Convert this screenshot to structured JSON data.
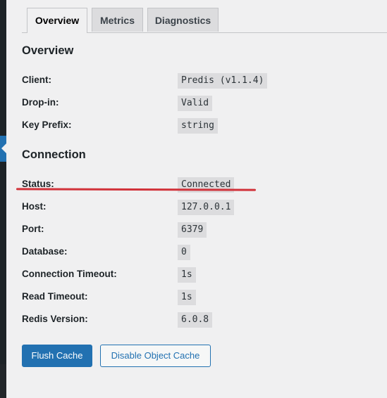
{
  "tabs": [
    {
      "label": "Overview",
      "active": true
    },
    {
      "label": "Metrics",
      "active": false
    },
    {
      "label": "Diagnostics",
      "active": false
    }
  ],
  "overview": {
    "heading": "Overview",
    "rows": [
      {
        "label": "Client:",
        "value": "Predis (v1.1.4)"
      },
      {
        "label": "Drop-in:",
        "value": "Valid"
      },
      {
        "label": "Key Prefix:",
        "value": "string"
      }
    ]
  },
  "connection": {
    "heading": "Connection",
    "rows": [
      {
        "label": "Status:",
        "value": "Connected"
      },
      {
        "label": "Host:",
        "value": "127.0.0.1"
      },
      {
        "label": "Port:",
        "value": "6379"
      },
      {
        "label": "Database:",
        "value": "0"
      },
      {
        "label": "Connection Timeout:",
        "value": "1s"
      },
      {
        "label": "Read Timeout:",
        "value": "1s"
      },
      {
        "label": "Redis Version:",
        "value": "6.0.8"
      }
    ]
  },
  "actions": {
    "flush_label": "Flush Cache",
    "disable_label": "Disable Object Cache"
  },
  "colors": {
    "accent": "#2271b1",
    "annotation": "#d1323a"
  }
}
